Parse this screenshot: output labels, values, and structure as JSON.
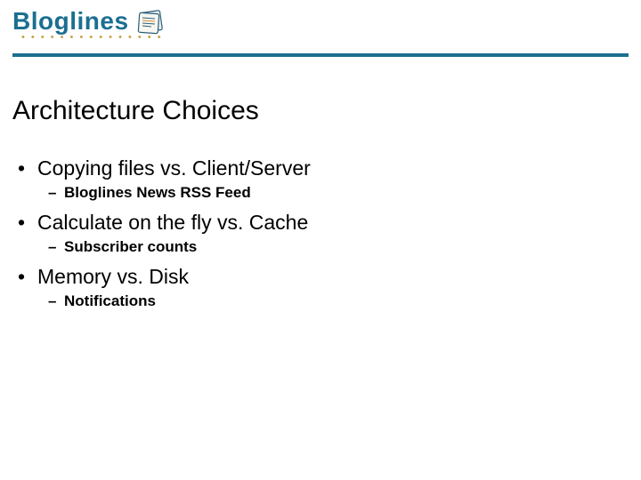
{
  "logo": {
    "text": "Bloglines",
    "icon_name": "newspaper-icon"
  },
  "title": "Architecture Choices",
  "bullets": [
    {
      "text": "Copying files vs. Client/Server",
      "sub": "Bloglines News RSS Feed"
    },
    {
      "text": "Calculate on the fly vs. Cache",
      "sub": "Subscriber counts"
    },
    {
      "text": "Memory vs. Disk",
      "sub": "Notifications"
    }
  ]
}
